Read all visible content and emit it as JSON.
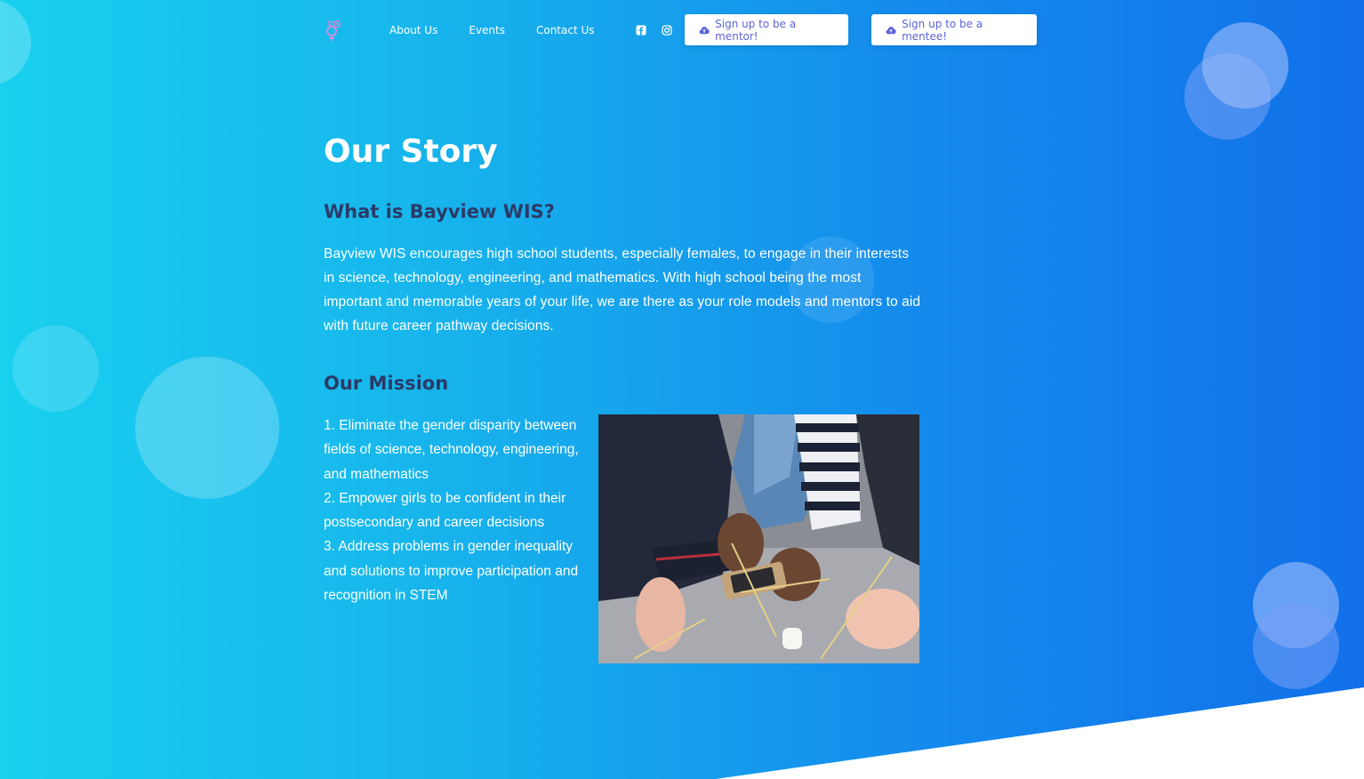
{
  "nav": {
    "links": [
      "About Us",
      "Events",
      "Contact Us"
    ],
    "social_icons": [
      "facebook-icon",
      "instagram-icon"
    ],
    "mentor_button": "Sign up to be a mentor!",
    "mentee_button": "Sign up to be a mentee!"
  },
  "main": {
    "title": "Our Story",
    "what_heading": "What is Bayview WIS?",
    "what_text": "Bayview WIS encourages high school students, especially females, to engage in their interests in science, technology, engineering, and mathematics. With high school being the most important and memorable years of your life, we are there as your role models and mentors to aid with future career pathway decisions.",
    "mission_heading": "Our Mission",
    "mission_items": [
      "1. Eliminate the gender disparity between fields of science, technology, engineering, and mathematics",
      "2. Empower girls to be confident in their postsecondary and career decisions",
      "3. Address problems in gender inequality and solutions to improve participation and recognition in STEM"
    ]
  },
  "colors": {
    "gradient_start": "#19d0ef",
    "gradient_end": "#1270ea",
    "heading": "#2b3a67",
    "button_text": "#5e64d6"
  }
}
